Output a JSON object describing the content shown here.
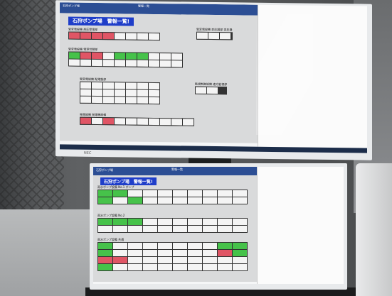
{
  "monitors": [
    {
      "id": "upper",
      "header_left": "石狩ポンプ場",
      "header_center": "警報一覧",
      "title": "石狩ポンプ場　警報一覧!",
      "brand": "NEC",
      "sections": [
        {
          "label": "受変電設備 高圧受電部",
          "cols": 8,
          "cells": [
            "red",
            "red",
            "red",
            "red",
            "white",
            "white",
            "white",
            "white"
          ]
        },
        {
          "label": "受変電設備 変圧器部 変圧器",
          "cols": 3,
          "cells": [
            "white",
            "white",
            "white"
          ]
        },
        {
          "label": "受変電設備 電源切替部",
          "cols": 10,
          "cells": [
            "green",
            "red",
            "red",
            "white",
            "green",
            "green",
            "green",
            "white",
            "white",
            "white",
            "white",
            "white",
            "white",
            "white",
            "white",
            "white",
            "white",
            "white",
            "white",
            "white"
          ]
        },
        {
          "label": "受変電設備 配電盤部",
          "cols": 7,
          "cells": [
            "white",
            "white",
            "white",
            "white",
            "white",
            "white",
            "white",
            "white",
            "white",
            "white",
            "white",
            "white",
            "white",
            "white",
            "white",
            "white",
            "white",
            "white",
            "white",
            "white",
            "white"
          ]
        },
        {
          "label": "監視制御設備 遠方監視部",
          "cols": 2,
          "cells": [
            "white",
            "white"
          ]
        },
        {
          "label": "発電設備 発電機設備",
          "cols": 10,
          "cells": [
            "red",
            "white",
            "red",
            "white",
            "white",
            "white",
            "white",
            "white",
            "white",
            "white"
          ]
        }
      ]
    },
    {
      "id": "lower",
      "header_left": "石狩ポンプ場",
      "header_center": "警報一覧",
      "title": "石狩ポンプ場　警報一覧!",
      "sections": [
        {
          "label": "雨水ポンプ設備 No.1 ポンプ",
          "cols": 10,
          "cells": [
            "green",
            "green",
            "white",
            "white",
            "white",
            "white",
            "white",
            "white",
            "white",
            "white",
            "green",
            "white",
            "green",
            "white",
            "white",
            "white",
            "white",
            "white",
            "white",
            "white"
          ]
        },
        {
          "label": "雨水ポンプ設備 No.2",
          "cols": 10,
          "cells": [
            "green",
            "green",
            "green",
            "white",
            "white",
            "white",
            "white",
            "white",
            "white",
            "white",
            "white",
            "white",
            "white",
            "white",
            "white",
            "white",
            "white",
            "white",
            "white",
            "white"
          ]
        },
        {
          "label": "雨水ポンプ設備 共通",
          "cols": 10,
          "cells": [
            "green",
            "white",
            "white",
            "white",
            "white",
            "white",
            "white",
            "white",
            "green",
            "green",
            "green",
            "white",
            "white",
            "white",
            "white",
            "white",
            "white",
            "white",
            "red",
            "green",
            "red",
            "red",
            "white",
            "white",
            "white",
            "white",
            "white",
            "white",
            "white",
            "white",
            "green",
            "white",
            "white",
            "white",
            "white",
            "white",
            "white",
            "white",
            "white",
            "white"
          ]
        }
      ]
    }
  ],
  "colors": {
    "alarm": "#e05565",
    "normal": "#46c24a",
    "idle": "#f4f4f4",
    "title_bg": "#1f3ec9"
  }
}
